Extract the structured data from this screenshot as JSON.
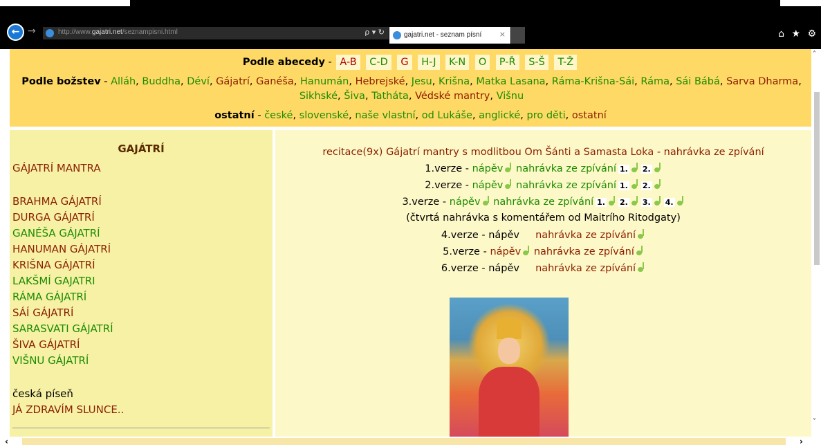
{
  "browser": {
    "url_prefix": "http://www.",
    "url_domain": "gajatri.net",
    "url_path": "/seznampisni.html",
    "search_glyph": "ρ ▾ ↻",
    "tab_title": "gajatri.net - seznam písní",
    "tab_close": "×",
    "back_glyph": "←",
    "forward_glyph": "→",
    "right_icons": "⌂ ★ ⚙"
  },
  "header": {
    "alphabet_label": "Podle abecedy",
    "dash": " - ",
    "letters": [
      "A-B",
      "C-D",
      "G",
      "H-J",
      "K-N",
      "O",
      "P-Ř",
      "S-Š",
      "T-Ž"
    ],
    "deities_label": "Podle božstev",
    "deities": [
      "Alláh",
      "Buddha",
      "Déví",
      "Gájatrí",
      "Ganéša",
      "Hanumán",
      "Hebrejské",
      "Jesu",
      "Krišna",
      "Matka Lasana",
      "Ráma-Krišna-Sái",
      "Ráma",
      "Sái Bábá",
      "Sarva Dharma",
      "Sikhské",
      "Šiva",
      "Tatháta",
      "Védské mantry",
      "Višnu"
    ],
    "other_label": "ostatní",
    "others": [
      "české",
      "slovenské",
      "naše vlastní",
      "od Lukáše",
      "anglické",
      "pro děti",
      "ostatní"
    ]
  },
  "sidebar": {
    "title": "GAJÁTRÍ",
    "items": [
      "GÁJATRÍ MANTRA",
      "BRAHMA GÁJATRÍ",
      "DURGA GÁJATRÍ",
      "GANÉŠA GÁJATRÍ",
      "HANUMAN GÁJATRÍ",
      "KRIŠNA GÁJATRÍ",
      "LAKŠMÍ GAJATRI",
      "RÁMA GÁJATRÍ",
      "SÁÍ GÁJATRÍ",
      "SARASVATI GÁJATRÍ",
      "ŠIVA GÁJATRÍ",
      "VIŠNU GÁJATRÍ"
    ],
    "czech_label": "česká píseň",
    "czech_song": "JÁ ZDRAVÍM SLUNCE.."
  },
  "main": {
    "recitation": "recitace(9x) Gájatrí mantry s modlitbou Om Šánti a Samasta Loka - nahrávka ze zpívání",
    "verse1": "1.verze",
    "verse2": "2.verze",
    "verse3": "3.verze",
    "verse4": "4.verze",
    "verse5": "5.verze",
    "verse6": "6.verze",
    "dash": " - ",
    "melody": "nápěv",
    "recording": "nahrávka ze zpívání",
    "rec1": "1.",
    "rec2": "2.",
    "rec3": "3.",
    "rec4": "4.",
    "commentary": "(čtvrtá nahrávka s komentářem od Maitrího Ritodgaty)"
  },
  "scroll": {
    "left_glyph": "‹",
    "right_glyph": "›",
    "up_glyph": "˄",
    "down_glyph": "˅"
  }
}
